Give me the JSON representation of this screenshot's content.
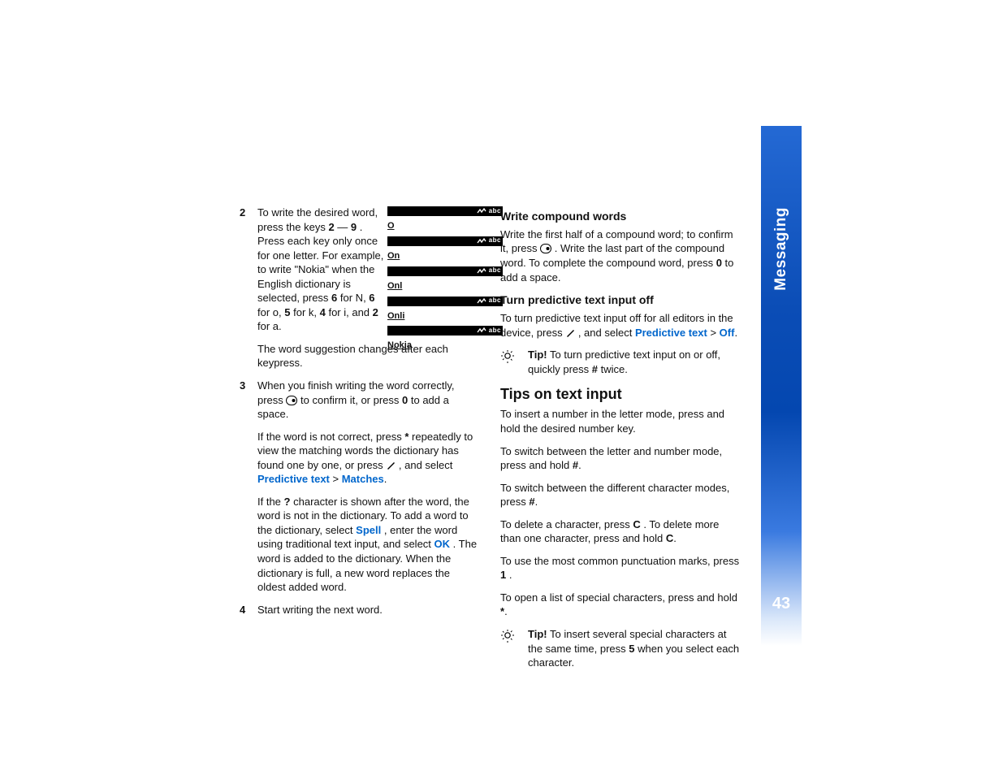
{
  "side": {
    "title": "Messaging",
    "page": "43"
  },
  "fig": {
    "abc": "abc",
    "words": [
      "O",
      "On",
      "Onl",
      "Onli",
      "Nokia"
    ]
  },
  "left": {
    "step2": {
      "num": "2",
      "l1a": "To write the desired word, press the keys ",
      "k2": "2",
      "dash": " — ",
      "k9": "9",
      "l1b": ". Press each key only once for one letter. For example, to write \"Nokia\" when the English dictionary is selected, press ",
      "k6a": "6",
      "t_forN": " for N, ",
      "k6b": "6",
      "t_foro": " for o, ",
      "k5": "5",
      "t_fork": " for k, ",
      "k4": "4",
      "t_fori": " for i, and ",
      "k2b": "2",
      "t_fora": " for a.",
      "sugg": "The word suggestion changes after each keypress."
    },
    "step3": {
      "num": "3",
      "a1": "When you finish writing the word correctly, press ",
      "a2": " to confirm it, or press ",
      "k0": "0",
      "a3": " to add a space.",
      "b1": "If the word is not correct, press ",
      "star": "*",
      "b2": " repeatedly to view the matching words the dictionary has found one by one, or press ",
      "b3": ", and select ",
      "plink1": "Predictive text",
      "gt": " > ",
      "plink2": "Matches",
      "b4": ".",
      "c1": "If the ",
      "q": "?",
      "c2": " character is shown after the word, the word is not in the dictionary. To add a word to the dictionary, select ",
      "spell": "Spell",
      "c3": ", enter the word using traditional text input, and select ",
      "ok": "OK",
      "c4": ". The word is added to the dictionary. When the dictionary is full, a new word replaces the oldest added word."
    },
    "step4": {
      "num": "4",
      "t": "Start writing the next word."
    }
  },
  "right": {
    "h_comp": "Write compound words",
    "comp1": "Write the first half of a compound word; to confirm it, press ",
    "comp2": ". Write the last part of the compound word. To complete the compound word, press ",
    "k0": "0",
    "comp3": " to add a space.",
    "h_off": "Turn predictive text input off",
    "off1": "To turn predictive text input off for all editors in the device, press ",
    "off2": ", and select ",
    "offlink1": "Predictive text",
    "gt": " > ",
    "offlink2": "Off",
    "off3": ".",
    "tip1_lbl": "Tip!",
    "tip1": " To turn predictive text input on or off, quickly press ",
    "hash": "#",
    "tip1b": " twice.",
    "h_tips": "Tips on text input",
    "t1": "To insert a number in the letter mode, press and hold the desired number key.",
    "t2a": "To switch between the letter and number mode, press and hold ",
    "t2b": ".",
    "t3a": "To switch between the different character modes, press ",
    "t3b": ".",
    "t4a": "To delete a character, press ",
    "cKey": "C",
    "t4b": ". To delete more than one character, press and hold ",
    "t4c": ".",
    "t5a": "To use the most common punctuation marks, press ",
    "k1": "1",
    "t5b": " .",
    "t6a": "To open a list of special characters, press and hold ",
    "star": "*",
    "t6b": ".",
    "tip2_lbl": "Tip!",
    "tip2a": " To insert several special characters at the same time, press ",
    "k5": "5",
    "tip2b": " when you select each character."
  }
}
